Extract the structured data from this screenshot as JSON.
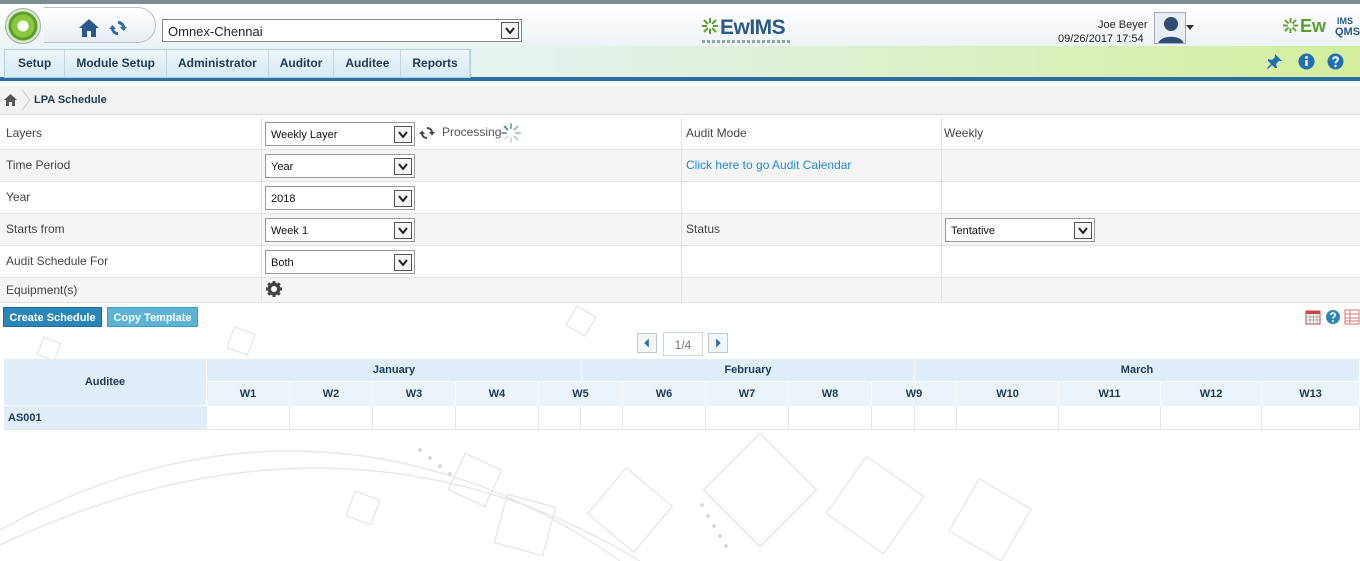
{
  "header": {
    "site_selected": "Omnex-Chennai",
    "center_logo": "EwIMS",
    "user_name": "Joe Beyer",
    "date_time": "09/26/2017 17:54",
    "right_logo_main": "Ew",
    "right_logo_ims": "IMS",
    "right_logo_qms": "QMS"
  },
  "nav": {
    "tabs": [
      {
        "label": "Setup"
      },
      {
        "label": "Module Setup"
      },
      {
        "label": "Administrator"
      },
      {
        "label": "Auditor"
      },
      {
        "label": "Auditee"
      },
      {
        "label": "Reports"
      }
    ]
  },
  "breadcrumb": {
    "title": "LPA Schedule"
  },
  "form": {
    "layers_label": "Layers",
    "layers_value": "Weekly Layer",
    "processing_text": "Processing",
    "audit_mode_label": "Audit Mode",
    "audit_mode_value": "Weekly",
    "time_period_label": "Time Period",
    "time_period_value": "Year",
    "calendar_link": "Click here to go Audit Calendar",
    "year_label": "Year",
    "year_value": "2018",
    "starts_from_label": "Starts from",
    "starts_from_value": "Week 1",
    "status_label": "Status",
    "status_value": "Tentative",
    "schedule_for_label": "Audit Schedule For",
    "schedule_for_value": "Both",
    "equipment_label": "Equipment(s)"
  },
  "actions": {
    "create_schedule": "Create Schedule",
    "copy_template": "Copy Template"
  },
  "pager": {
    "label": "1/4"
  },
  "grid": {
    "auditee_header": "Auditee",
    "months": [
      "January",
      "February",
      "March"
    ],
    "weeks": [
      "W1",
      "W2",
      "W3",
      "W4",
      "W5",
      "W6",
      "W7",
      "W8",
      "W9",
      "W10",
      "W11",
      "W12",
      "W13"
    ],
    "rows": [
      {
        "auditee": "AS001"
      }
    ]
  },
  "colors": {
    "accent_blue": "#2b86b8",
    "nav_green": "#d4ee9c",
    "link_blue": "#1f8ad2"
  }
}
